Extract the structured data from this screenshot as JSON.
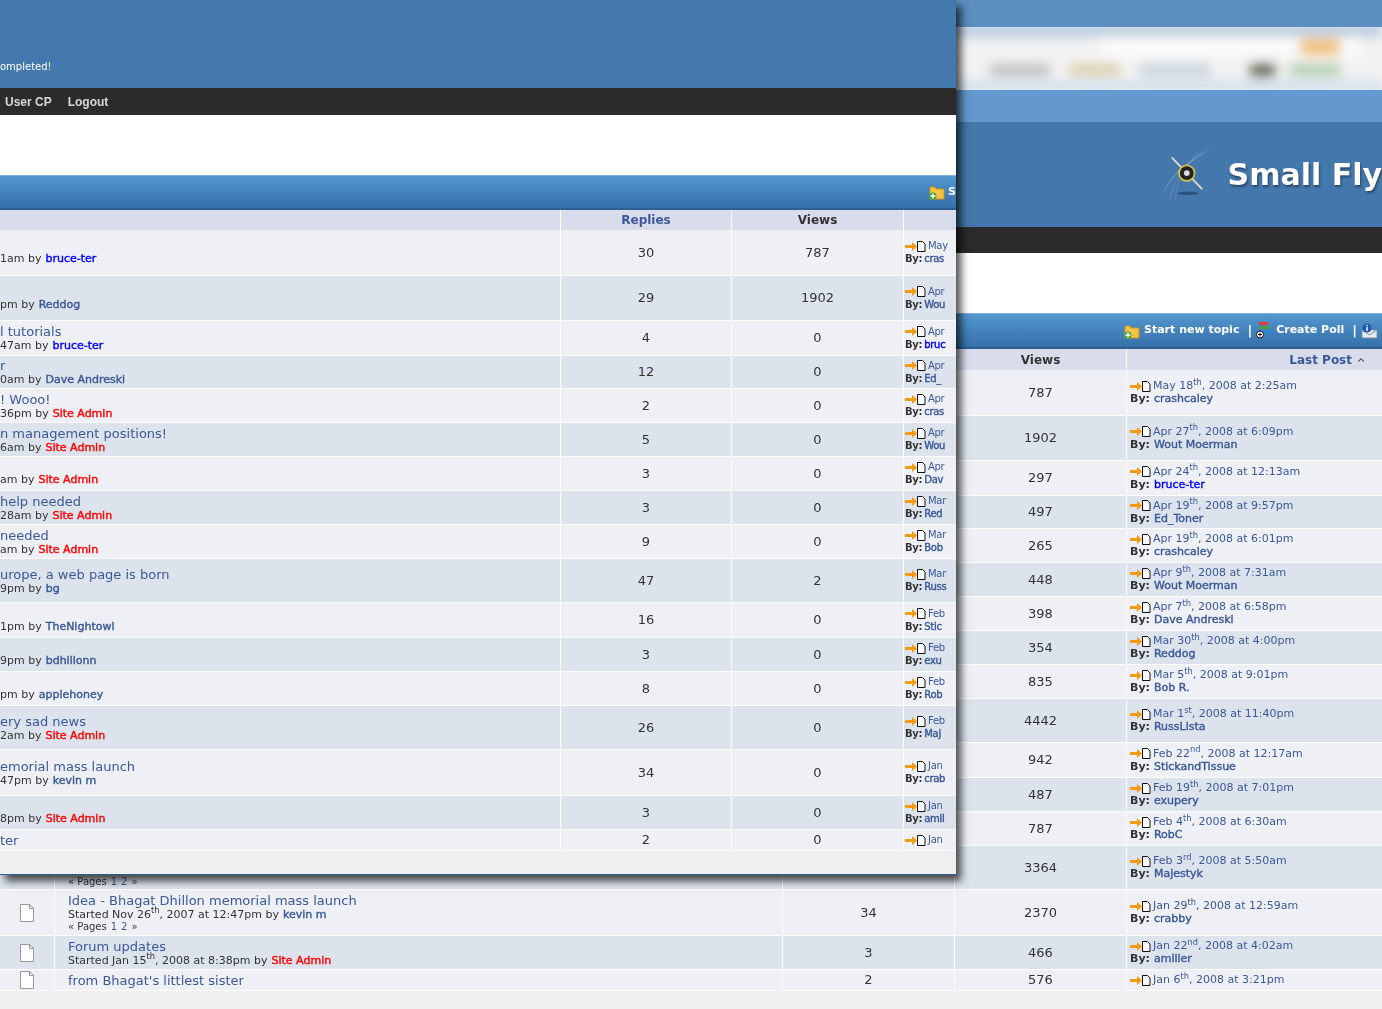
{
  "back_window": {
    "logo": "Small Fly",
    "toolbar": [
      {
        "kind": "topic",
        "label": "Start new topic"
      },
      {
        "kind": "poll",
        "label": "Create Poll"
      },
      {
        "kind": "info"
      }
    ],
    "separator": "|",
    "columns": [
      {
        "label": "Views",
        "link": false,
        "sorted": false
      },
      {
        "label": "Last Post",
        "link": true,
        "sorted": true
      }
    ],
    "rows": [
      {
        "views": "787",
        "last": {
          "date": "May 18$^{th}$, 2008 at 2:25am",
          "by_label": "By:",
          "author": {
            "name": "crashcaley",
            "color": "#3b5998"
          }
        }
      },
      {
        "views": "1902",
        "last": {
          "date": "Apr 27$^{th}$, 2008 at 6:09pm",
          "by_label": "By:",
          "author": {
            "name": "Wout Moerman",
            "color": "#3b5998"
          }
        }
      },
      {
        "views": "297",
        "last": {
          "date": "Apr 24$^{th}$, 2008 at 12:13am",
          "by_label": "By:",
          "author": {
            "name": "bruce-ter",
            "color": "#0000ff"
          }
        }
      },
      {
        "views": "497",
        "last": {
          "date": "Apr 19$^{th}$, 2008 at 9:57pm",
          "by_label": "By:",
          "author": {
            "name": "Ed_Toner",
            "color": "#3b5998"
          }
        }
      },
      {
        "views": "265",
        "last": {
          "date": "Apr 19$^{th}$, 2008 at 6:01pm",
          "by_label": "By:",
          "author": {
            "name": "crashcaley",
            "color": "#3b5998"
          }
        }
      },
      {
        "views": "448",
        "last": {
          "date": "Apr 9$^{th}$, 2008 at 7:31am",
          "by_label": "By:",
          "author": {
            "name": "Wout Moerman",
            "color": "#3b5998"
          }
        }
      },
      {
        "views": "398",
        "last": {
          "date": "Apr 7$^{th}$, 2008 at 6:58pm",
          "by_label": "By:",
          "author": {
            "name": "Dave Andreski",
            "color": "#3b5998"
          }
        }
      },
      {
        "views": "354",
        "last": {
          "date": "Mar 30$^{th}$, 2008 at 4:00pm",
          "by_label": "By:",
          "author": {
            "name": "Reddog",
            "color": "#3b5998"
          }
        }
      },
      {
        "views": "835",
        "last": {
          "date": "Mar 5$^{th}$, 2008 at 9:01pm",
          "by_label": "By:",
          "author": {
            "name": "Bob R.",
            "color": "#3b5998"
          }
        }
      },
      {
        "views": "4442",
        "last": {
          "date": "Mar 1$^{st}$, 2008 at 11:40pm",
          "by_label": "By:",
          "author": {
            "name": "RussLista",
            "color": "#3b5998"
          }
        }
      },
      {
        "views": "942",
        "last": {
          "date": "Feb 22$^{nd}$, 2008 at 12:17am",
          "by_label": "By:",
          "author": {
            "name": "StickandTissue",
            "color": "#3b5998"
          }
        }
      },
      {
        "views": "487",
        "last": {
          "date": "Feb 19$^{th}$, 2008 at 7:01pm",
          "by_label": "By:",
          "author": {
            "name": "exupery",
            "color": "#3b5998"
          }
        }
      },
      {
        "views": "787",
        "last": {
          "date": "Feb 4$^{th}$, 2008 at 6:30am",
          "by_label": "By:",
          "author": {
            "name": "RobC",
            "color": "#3b5998"
          }
        }
      },
      {
        "pages": {
          "prefix": "« Pages",
          "links": [
            "1",
            "2"
          ],
          "suffix": "»"
        },
        "views": "3364",
        "last": {
          "date": "Feb 3$^{rd}$, 2008 at 5:50am",
          "by_label": "By:",
          "author": {
            "name": "Majestyk",
            "color": "#3b5998"
          }
        }
      },
      {
        "title": "Idea - Bhagat Dhillon memorial mass launch",
        "started": "Started Nov 26$^{th}$, 2007 at 12:47pm by",
        "author": {
          "name": "kevin m",
          "color": "#3b5998"
        },
        "pages": {
          "prefix": "« Pages",
          "links": [
            "1",
            "2"
          ],
          "suffix": "»"
        },
        "replies": "34",
        "views": "2370",
        "last": {
          "date": "Jan 29$^{th}$, 2008 at 12:59am",
          "by_label": "By:",
          "author": {
            "name": "crabby",
            "color": "#3b5998"
          }
        }
      },
      {
        "title": "Forum updates",
        "started": "Started Jan 15$^{th}$, 2008 at 8:38pm by",
        "author": {
          "name": "Site Admin",
          "color": "#ff0000"
        },
        "replies": "3",
        "views": "466",
        "last": {
          "date": "Jan 22$^{nd}$, 2008 at 4:02am",
          "by_label": "By:",
          "author": {
            "name": "amiller",
            "color": "#3b5998"
          }
        }
      },
      {
        "title": "from Bhagat's littlest sister",
        "replies": "2",
        "views": "576",
        "last": {
          "date": "Jan 6$^{th}$, 2008 at 3:21pm"
        }
      }
    ]
  },
  "front_window": {
    "header_text": "ompleted!",
    "nav": [
      "User CP",
      "Logout"
    ],
    "toolbar_text": "S",
    "columns": [
      {
        "label": "Replies",
        "link": true
      },
      {
        "label": "Views",
        "link": false
      }
    ],
    "rows": [
      {
        "started": "1am by",
        "author": {
          "name": "bruce-ter",
          "color": "#0000ff"
        },
        "replies": "30",
        "views": "787",
        "last": {
          "date": "May",
          "by_label": "By:",
          "author": {
            "name": "cras",
            "color": "#3b5998"
          }
        }
      },
      {
        "started": "pm by",
        "author": {
          "name": "Reddog",
          "color": "#3b5998"
        },
        "replies": "29",
        "views": "1902",
        "last": {
          "date": "Apr",
          "by_label": "By:",
          "author": {
            "name": "Wou",
            "color": "#3b5998"
          }
        }
      },
      {
        "title": "l tutorials",
        "started": "47am by",
        "author": {
          "name": "bruce-ter",
          "color": "#0000ff"
        },
        "replies": "4",
        "views": "0",
        "last": {
          "date": "Apr",
          "by_label": "By:",
          "author": {
            "name": "bruc",
            "color": "#0000ff"
          }
        }
      },
      {
        "title": "r",
        "started": "0am by",
        "author": {
          "name": "Dave Andreski",
          "color": "#3b5998"
        },
        "replies": "12",
        "views": "0",
        "last": {
          "date": "Apr",
          "by_label": "By:",
          "author": {
            "name": "Ed_",
            "color": "#3b5998"
          }
        }
      },
      {
        "title": "! Wooo!",
        "started": "36pm by",
        "author": {
          "name": "Site Admin",
          "color": "#ff0000"
        },
        "replies": "2",
        "views": "0",
        "last": {
          "date": "Apr",
          "by_label": "By:",
          "author": {
            "name": "cras",
            "color": "#3b5998"
          }
        }
      },
      {
        "title": "n management positions!",
        "started": "6am by",
        "author": {
          "name": "Site Admin",
          "color": "#ff0000"
        },
        "replies": "5",
        "views": "0",
        "last": {
          "date": "Apr",
          "by_label": "By:",
          "author": {
            "name": "Wou",
            "color": "#3b5998"
          }
        }
      },
      {
        "started": "am by",
        "author": {
          "name": "Site Admin",
          "color": "#ff0000"
        },
        "replies": "3",
        "views": "0",
        "last": {
          "date": "Apr",
          "by_label": "By:",
          "author": {
            "name": "Dav",
            "color": "#3b5998"
          }
        }
      },
      {
        "title": "help needed",
        "started": "28am by",
        "author": {
          "name": "Site Admin",
          "color": "#ff0000"
        },
        "replies": "3",
        "views": "0",
        "last": {
          "date": "Mar",
          "by_label": "By:",
          "author": {
            "name": "Red",
            "color": "#3b5998"
          }
        }
      },
      {
        "title": "needed",
        "started": "am by",
        "author": {
          "name": "Site Admin",
          "color": "#ff0000"
        },
        "replies": "9",
        "views": "0",
        "last": {
          "date": "Mar",
          "by_label": "By:",
          "author": {
            "name": "Bob",
            "color": "#3b5998"
          }
        }
      },
      {
        "title": "urope, a web page is born",
        "started": "9pm by",
        "author": {
          "name": "bg",
          "color": "#3b5998"
        },
        "replies": "47",
        "views": "2",
        "last": {
          "date": "Mar",
          "by_label": "By:",
          "author": {
            "name": "Russ",
            "color": "#3b5998"
          }
        }
      },
      {
        "started": "1pm by",
        "author": {
          "name": "TheNightowl",
          "color": "#3b5998"
        },
        "replies": "16",
        "views": "0",
        "last": {
          "date": "Feb",
          "by_label": "By:",
          "author": {
            "name": "Stic",
            "color": "#3b5998"
          }
        }
      },
      {
        "started": "9pm by",
        "author": {
          "name": "bdhillonn",
          "color": "#3b5998"
        },
        "replies": "3",
        "views": "0",
        "last": {
          "date": "Feb",
          "by_label": "By:",
          "author": {
            "name": "exu",
            "color": "#3b5998"
          }
        }
      },
      {
        "started": "pm by",
        "author": {
          "name": "applehoney",
          "color": "#3b5998"
        },
        "replies": "8",
        "views": "0",
        "last": {
          "date": "Feb",
          "by_label": "By:",
          "author": {
            "name": "Rob",
            "color": "#3b5998"
          }
        }
      },
      {
        "title": "ery sad news",
        "started": "2am by",
        "author": {
          "name": "Site Admin",
          "color": "#ff0000"
        },
        "replies": "26",
        "views": "0",
        "last": {
          "date": "Feb",
          "by_label": "By:",
          "author": {
            "name": "Maj",
            "color": "#3b5998"
          }
        }
      },
      {
        "title": "emorial mass launch",
        "started": "47pm by",
        "author": {
          "name": "kevin m",
          "color": "#3b5998"
        },
        "replies": "34",
        "views": "0",
        "last": {
          "date": "Jan",
          "by_label": "By:",
          "author": {
            "name": "crab",
            "color": "#3b5998"
          }
        }
      },
      {
        "started": "8pm by",
        "author": {
          "name": "Site Admin",
          "color": "#ff0000"
        },
        "replies": "3",
        "views": "0",
        "last": {
          "date": "Jan",
          "by_label": "By:",
          "author": {
            "name": "amil",
            "color": "#3b5998"
          }
        }
      },
      {
        "title": "ter",
        "replies": "2",
        "views": "0",
        "last": {
          "date": "Jan"
        }
      }
    ]
  }
}
